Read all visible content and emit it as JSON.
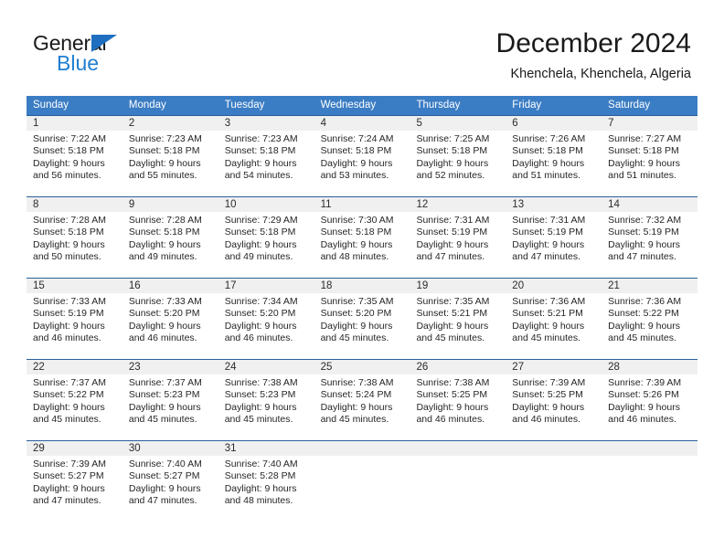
{
  "brand": {
    "name_top": "General",
    "name_bottom": "Blue",
    "triangle_color": "#1f6fc0",
    "blue_text_color": "#1f7fd0"
  },
  "header": {
    "title": "December 2024",
    "subtitle": "Khenchela, Khenchela, Algeria"
  },
  "theme": {
    "header_bar_color": "#3b7dc4",
    "row_rule_color": "#2a6099",
    "date_band_color": "#f0f0f0",
    "text_color": "#262626"
  },
  "calendar": {
    "weekday_headers": [
      "Sunday",
      "Monday",
      "Tuesday",
      "Wednesday",
      "Thursday",
      "Friday",
      "Saturday"
    ],
    "weeks": [
      [
        {
          "date": "1",
          "sunrise": "Sunrise: 7:22 AM",
          "sunset": "Sunset: 5:18 PM",
          "daylight_1": "Daylight: 9 hours",
          "daylight_2": "and 56 minutes."
        },
        {
          "date": "2",
          "sunrise": "Sunrise: 7:23 AM",
          "sunset": "Sunset: 5:18 PM",
          "daylight_1": "Daylight: 9 hours",
          "daylight_2": "and 55 minutes."
        },
        {
          "date": "3",
          "sunrise": "Sunrise: 7:23 AM",
          "sunset": "Sunset: 5:18 PM",
          "daylight_1": "Daylight: 9 hours",
          "daylight_2": "and 54 minutes."
        },
        {
          "date": "4",
          "sunrise": "Sunrise: 7:24 AM",
          "sunset": "Sunset: 5:18 PM",
          "daylight_1": "Daylight: 9 hours",
          "daylight_2": "and 53 minutes."
        },
        {
          "date": "5",
          "sunrise": "Sunrise: 7:25 AM",
          "sunset": "Sunset: 5:18 PM",
          "daylight_1": "Daylight: 9 hours",
          "daylight_2": "and 52 minutes."
        },
        {
          "date": "6",
          "sunrise": "Sunrise: 7:26 AM",
          "sunset": "Sunset: 5:18 PM",
          "daylight_1": "Daylight: 9 hours",
          "daylight_2": "and 51 minutes."
        },
        {
          "date": "7",
          "sunrise": "Sunrise: 7:27 AM",
          "sunset": "Sunset: 5:18 PM",
          "daylight_1": "Daylight: 9 hours",
          "daylight_2": "and 51 minutes."
        }
      ],
      [
        {
          "date": "8",
          "sunrise": "Sunrise: 7:28 AM",
          "sunset": "Sunset: 5:18 PM",
          "daylight_1": "Daylight: 9 hours",
          "daylight_2": "and 50 minutes."
        },
        {
          "date": "9",
          "sunrise": "Sunrise: 7:28 AM",
          "sunset": "Sunset: 5:18 PM",
          "daylight_1": "Daylight: 9 hours",
          "daylight_2": "and 49 minutes."
        },
        {
          "date": "10",
          "sunrise": "Sunrise: 7:29 AM",
          "sunset": "Sunset: 5:18 PM",
          "daylight_1": "Daylight: 9 hours",
          "daylight_2": "and 49 minutes."
        },
        {
          "date": "11",
          "sunrise": "Sunrise: 7:30 AM",
          "sunset": "Sunset: 5:18 PM",
          "daylight_1": "Daylight: 9 hours",
          "daylight_2": "and 48 minutes."
        },
        {
          "date": "12",
          "sunrise": "Sunrise: 7:31 AM",
          "sunset": "Sunset: 5:19 PM",
          "daylight_1": "Daylight: 9 hours",
          "daylight_2": "and 47 minutes."
        },
        {
          "date": "13",
          "sunrise": "Sunrise: 7:31 AM",
          "sunset": "Sunset: 5:19 PM",
          "daylight_1": "Daylight: 9 hours",
          "daylight_2": "and 47 minutes."
        },
        {
          "date": "14",
          "sunrise": "Sunrise: 7:32 AM",
          "sunset": "Sunset: 5:19 PM",
          "daylight_1": "Daylight: 9 hours",
          "daylight_2": "and 47 minutes."
        }
      ],
      [
        {
          "date": "15",
          "sunrise": "Sunrise: 7:33 AM",
          "sunset": "Sunset: 5:19 PM",
          "daylight_1": "Daylight: 9 hours",
          "daylight_2": "and 46 minutes."
        },
        {
          "date": "16",
          "sunrise": "Sunrise: 7:33 AM",
          "sunset": "Sunset: 5:20 PM",
          "daylight_1": "Daylight: 9 hours",
          "daylight_2": "and 46 minutes."
        },
        {
          "date": "17",
          "sunrise": "Sunrise: 7:34 AM",
          "sunset": "Sunset: 5:20 PM",
          "daylight_1": "Daylight: 9 hours",
          "daylight_2": "and 46 minutes."
        },
        {
          "date": "18",
          "sunrise": "Sunrise: 7:35 AM",
          "sunset": "Sunset: 5:20 PM",
          "daylight_1": "Daylight: 9 hours",
          "daylight_2": "and 45 minutes."
        },
        {
          "date": "19",
          "sunrise": "Sunrise: 7:35 AM",
          "sunset": "Sunset: 5:21 PM",
          "daylight_1": "Daylight: 9 hours",
          "daylight_2": "and 45 minutes."
        },
        {
          "date": "20",
          "sunrise": "Sunrise: 7:36 AM",
          "sunset": "Sunset: 5:21 PM",
          "daylight_1": "Daylight: 9 hours",
          "daylight_2": "and 45 minutes."
        },
        {
          "date": "21",
          "sunrise": "Sunrise: 7:36 AM",
          "sunset": "Sunset: 5:22 PM",
          "daylight_1": "Daylight: 9 hours",
          "daylight_2": "and 45 minutes."
        }
      ],
      [
        {
          "date": "22",
          "sunrise": "Sunrise: 7:37 AM",
          "sunset": "Sunset: 5:22 PM",
          "daylight_1": "Daylight: 9 hours",
          "daylight_2": "and 45 minutes."
        },
        {
          "date": "23",
          "sunrise": "Sunrise: 7:37 AM",
          "sunset": "Sunset: 5:23 PM",
          "daylight_1": "Daylight: 9 hours",
          "daylight_2": "and 45 minutes."
        },
        {
          "date": "24",
          "sunrise": "Sunrise: 7:38 AM",
          "sunset": "Sunset: 5:23 PM",
          "daylight_1": "Daylight: 9 hours",
          "daylight_2": "and 45 minutes."
        },
        {
          "date": "25",
          "sunrise": "Sunrise: 7:38 AM",
          "sunset": "Sunset: 5:24 PM",
          "daylight_1": "Daylight: 9 hours",
          "daylight_2": "and 45 minutes."
        },
        {
          "date": "26",
          "sunrise": "Sunrise: 7:38 AM",
          "sunset": "Sunset: 5:25 PM",
          "daylight_1": "Daylight: 9 hours",
          "daylight_2": "and 46 minutes."
        },
        {
          "date": "27",
          "sunrise": "Sunrise: 7:39 AM",
          "sunset": "Sunset: 5:25 PM",
          "daylight_1": "Daylight: 9 hours",
          "daylight_2": "and 46 minutes."
        },
        {
          "date": "28",
          "sunrise": "Sunrise: 7:39 AM",
          "sunset": "Sunset: 5:26 PM",
          "daylight_1": "Daylight: 9 hours",
          "daylight_2": "and 46 minutes."
        }
      ],
      [
        {
          "date": "29",
          "sunrise": "Sunrise: 7:39 AM",
          "sunset": "Sunset: 5:27 PM",
          "daylight_1": "Daylight: 9 hours",
          "daylight_2": "and 47 minutes."
        },
        {
          "date": "30",
          "sunrise": "Sunrise: 7:40 AM",
          "sunset": "Sunset: 5:27 PM",
          "daylight_1": "Daylight: 9 hours",
          "daylight_2": "and 47 minutes."
        },
        {
          "date": "31",
          "sunrise": "Sunrise: 7:40 AM",
          "sunset": "Sunset: 5:28 PM",
          "daylight_1": "Daylight: 9 hours",
          "daylight_2": "and 48 minutes."
        },
        {
          "date": "",
          "sunrise": "",
          "sunset": "",
          "daylight_1": "",
          "daylight_2": ""
        },
        {
          "date": "",
          "sunrise": "",
          "sunset": "",
          "daylight_1": "",
          "daylight_2": ""
        },
        {
          "date": "",
          "sunrise": "",
          "sunset": "",
          "daylight_1": "",
          "daylight_2": ""
        },
        {
          "date": "",
          "sunrise": "",
          "sunset": "",
          "daylight_1": "",
          "daylight_2": ""
        }
      ]
    ]
  }
}
